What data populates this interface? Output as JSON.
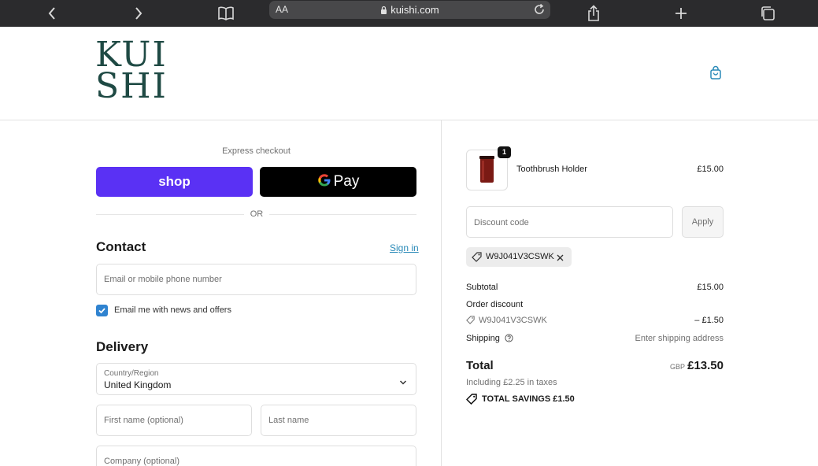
{
  "browser": {
    "text_size_label": "AA",
    "url": "kuishi.com"
  },
  "header": {
    "logo_line1": "KUI",
    "logo_line2": "SHI",
    "brand_color": "#1f4a44"
  },
  "express": {
    "label": "Express checkout",
    "shop_label": "shop",
    "gpay_label": "Pay",
    "or_label": "OR"
  },
  "contact": {
    "title": "Contact",
    "sign_in": "Sign in",
    "email_placeholder": "Email or mobile phone number",
    "newsletter_label": "Email me with news and offers",
    "newsletter_checked": true
  },
  "delivery": {
    "title": "Delivery",
    "country_label": "Country/Region",
    "country_value": "United Kingdom",
    "first_name_placeholder": "First name (optional)",
    "last_name_placeholder": "Last name",
    "company_placeholder": "Company (optional)"
  },
  "summary": {
    "product": {
      "name": "Toothbrush Holder",
      "price": "£15.00",
      "quantity": "1"
    },
    "discount_placeholder": "Discount code",
    "apply_label": "Apply",
    "applied_code": "W9J041V3CSWK",
    "subtotal_label": "Subtotal",
    "subtotal_value": "£15.00",
    "order_discount_label": "Order discount",
    "discount_code_line": "W9J041V3CSWK",
    "discount_value": "– £1.50",
    "shipping_label": "Shipping",
    "shipping_value": "Enter shipping address",
    "total_label": "Total",
    "currency": "GBP",
    "total_value": "£13.50",
    "tax_line": "Including £2.25 in taxes",
    "savings_label": "TOTAL SAVINGS  £1.50"
  },
  "colors": {
    "shop_purple": "#5a31f4",
    "link_blue": "#2a8ab8",
    "checkbox_blue": "#2f83d0"
  }
}
